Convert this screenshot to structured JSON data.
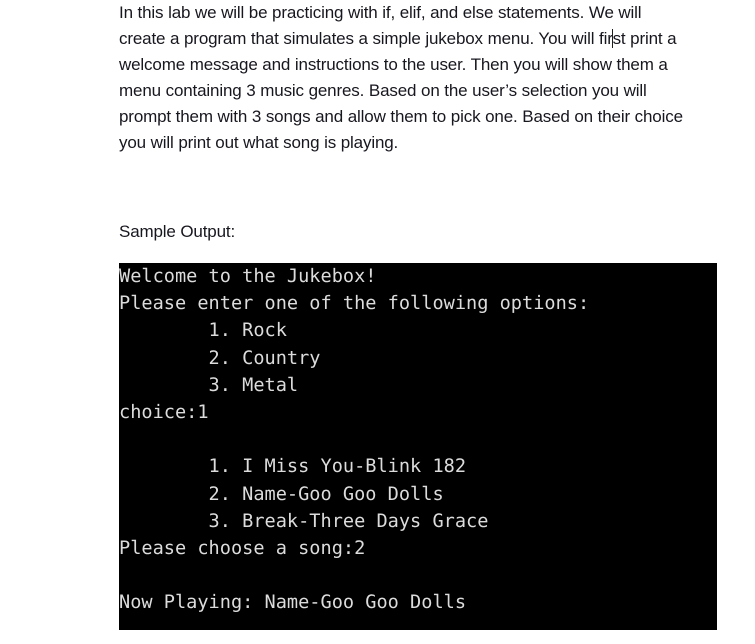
{
  "document": {
    "instructions_paragraph": {
      "segment_before_caret": "In this lab we will be practicing with if, elif, and else statements. We will create a program that simulates a simple jukebox menu. You will fir",
      "segment_after_caret": "st print a welcome message and instructions to the user. Then you will show them a menu containing 3 music genres. Based on the user’s selection you will prompt them with 3 songs and allow them to pick one. Based on their choice you will print out what song is playing.",
      "full_text": "In this lab we will be practicing with if, elif, and else statements. We will create a program that simulates a simple jukebox menu. You will first print a welcome message and instructions to the user. Then you will show them a menu containing 3 music genres. Based on the user’s selection you will prompt them with 3 songs and allow them to pick one. Based on their choice you will print out what song is playing.",
      "text_color": "#17171f"
    },
    "sample_output_label": "Sample Output:"
  },
  "console": {
    "background_color": "#000000",
    "text_color": "#dcdcdc",
    "lines": [
      "Welcome to the Jukebox!",
      "Please enter one of the following options:",
      "        1. Rock",
      "        2. Country",
      "        3. Metal",
      "choice:1",
      "",
      "        1. I Miss You-Blink 182",
      "        2. Name-Goo Goo Dolls",
      "        3. Break-Three Days Grace",
      "Please choose a song:2",
      "",
      "Now Playing: Name-Goo Goo Dolls"
    ],
    "menu": {
      "welcome_message": "Welcome to the Jukebox!",
      "prompt": "Please enter one of the following options:",
      "genres": [
        {
          "number": "1.",
          "name": "Rock"
        },
        {
          "number": "2.",
          "name": "Country"
        },
        {
          "number": "3.",
          "name": "Metal"
        }
      ],
      "choice_prompt": "choice:",
      "choice_value": "1"
    },
    "songs": {
      "items": [
        {
          "number": "1.",
          "title": "I Miss You-Blink 182"
        },
        {
          "number": "2.",
          "title": "Name-Goo Goo Dolls"
        },
        {
          "number": "3.",
          "title": "Break-Three Days Grace"
        }
      ],
      "choice_prompt": "Please choose a song:",
      "choice_value": "2"
    },
    "now_playing": {
      "label": "Now Playing: ",
      "value": "Name-Goo Goo Dolls"
    }
  }
}
